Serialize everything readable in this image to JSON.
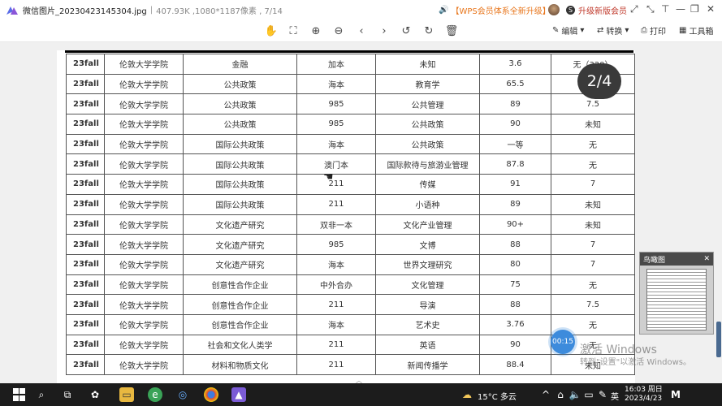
{
  "titlebar": {
    "filename": "微信图片_20230423145304.jpg",
    "meta": "407.93K ,1080*1187像素 , 7/14",
    "promo": "【WPS会员体系全新升级】",
    "upgrade": "升级新版会员",
    "upgrade_badge": "S"
  },
  "toolbar": {
    "edit": "编辑",
    "convert": "转换",
    "print": "打印",
    "tools": "工具箱"
  },
  "table": {
    "rows": [
      [
        "23fall",
        "伦敦大学学院",
        "金融",
        "加本",
        "未知",
        "3.6",
        "无（320）"
      ],
      [
        "23fall",
        "伦敦大学学院",
        "公共政策",
        "海本",
        "教育学",
        "65.5",
        ""
      ],
      [
        "23fall",
        "伦敦大学学院",
        "公共政策",
        "985",
        "公共管理",
        "89",
        "7.5"
      ],
      [
        "23fall",
        "伦敦大学学院",
        "公共政策",
        "985",
        "公共政策",
        "90",
        "未知"
      ],
      [
        "23fall",
        "伦敦大学学院",
        "国际公共政策",
        "海本",
        "公共政策",
        "一等",
        "无"
      ],
      [
        "23fall",
        "伦敦大学学院",
        "国际公共政策",
        "澳门本",
        "国际款待与旅游业管理",
        "87.8",
        "无"
      ],
      [
        "23fall",
        "伦敦大学学院",
        "国际公共政策",
        "211",
        "传媒",
        "91",
        "7"
      ],
      [
        "23fall",
        "伦敦大学学院",
        "国际公共政策",
        "211",
        "小语种",
        "89",
        "未知"
      ],
      [
        "23fall",
        "伦敦大学学院",
        "文化遗产研究",
        "双非一本",
        "文化产业管理",
        "90+",
        "未知"
      ],
      [
        "23fall",
        "伦敦大学学院",
        "文化遗产研究",
        "985",
        "文博",
        "88",
        "7"
      ],
      [
        "23fall",
        "伦敦大学学院",
        "文化遗产研究",
        "海本",
        "世界文理研究",
        "80",
        "7"
      ],
      [
        "23fall",
        "伦敦大学学院",
        "创意性合作企业",
        "中外合办",
        "文化管理",
        "75",
        "无"
      ],
      [
        "23fall",
        "伦敦大学学院",
        "创意性合作企业",
        "211",
        "导演",
        "88",
        "7.5"
      ],
      [
        "23fall",
        "伦敦大学学院",
        "创意性合作企业",
        "海本",
        "艺术史",
        "3.76",
        "无"
      ],
      [
        "23fall",
        "伦敦大学学院",
        "社会和文化人类学",
        "211",
        "英语",
        "90",
        "无"
      ],
      [
        "23fall",
        "伦敦大学学院",
        "材料和物质文化",
        "211",
        "新闻传播学",
        "88.4",
        "未知"
      ]
    ]
  },
  "viewer": {
    "page_indicator": "2/4",
    "overview_title": "鸟瞰图",
    "overview_close": "✕",
    "timer": "00:15",
    "watermark_title": "激活 Windows",
    "watermark_sub": "转到\"设置\"以激活 Windows。"
  },
  "taskbar": {
    "weather": "15°C 多云",
    "ime": "英",
    "time": "16:03 周日",
    "date": "2023/4/23"
  },
  "colors": {
    "promo": "#e8761c",
    "upgrade": "#c0392b",
    "badge_bg": "#3a3a3a",
    "timer_bg": "#3d8bdc",
    "taskbar_bg": "#1c1c1c"
  }
}
